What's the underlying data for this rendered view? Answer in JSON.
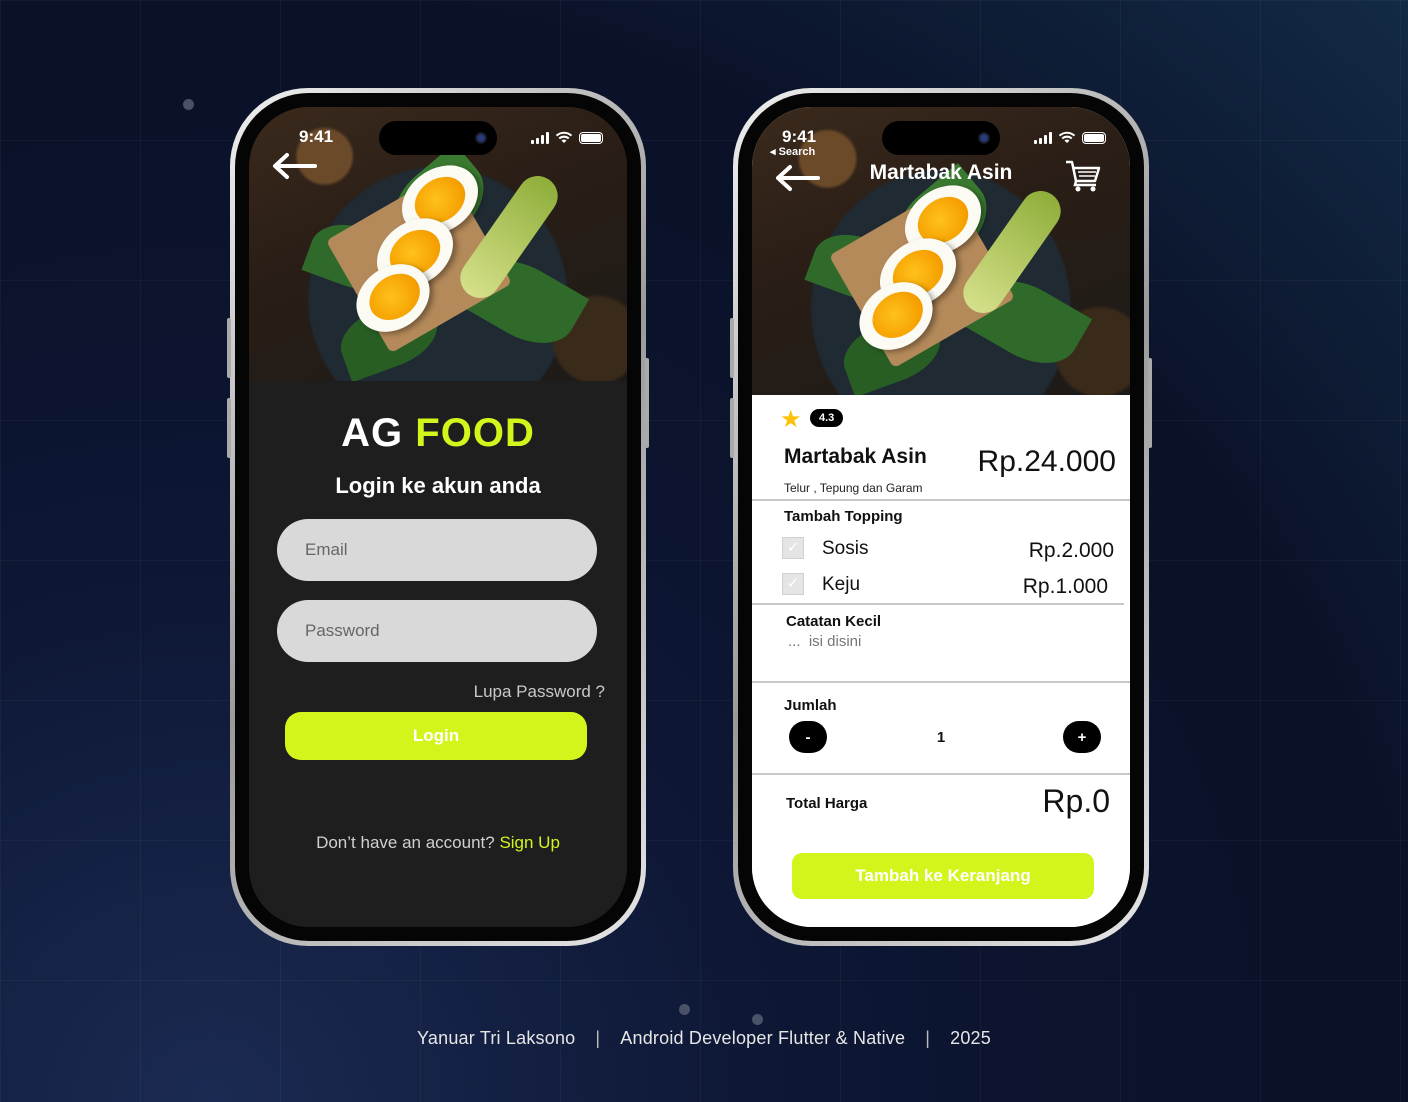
{
  "status_bar": {
    "time": "9:41",
    "search_back": "◂ Search"
  },
  "login": {
    "brand_part1": "AG",
    "brand_part2": "FOOD",
    "subtitle": "Login ke akun anda",
    "email_placeholder": "Email",
    "password_placeholder": "Password",
    "forgot_label": "Lupa Password ?",
    "login_label": "Login",
    "signup_prompt": "Don’t have an account?",
    "signup_link": "Sign Up"
  },
  "detail": {
    "nav_title": "Martabak Asin",
    "rating": "4.3",
    "name": "Martabak Asin",
    "price": "Rp.24.000",
    "description": "Telur , Tepung  dan Garam",
    "topping_title": "Tambah Topping",
    "toppings": [
      {
        "name": "Sosis",
        "price": "Rp.2.000"
      },
      {
        "name": "Keju",
        "price": "Rp.1.000"
      }
    ],
    "note_title": "Catatan  Kecil",
    "note_placeholder": "...  isi disini",
    "qty_title": "Jumlah",
    "qty_minus": "-",
    "qty_value": "1",
    "qty_plus": "+",
    "total_label": "Total Harga",
    "total_value": "Rp.0",
    "add_to_cart": "Tambah ke Keranjang"
  },
  "footer": {
    "author": "Yanuar Tri Laksono",
    "role": "Android Developer Flutter & Native",
    "year": "2025"
  },
  "colors": {
    "accent": "#d4f51c",
    "dark_bg": "#1e1e1e",
    "page_bg": "#0a1128"
  },
  "icons": [
    "back-arrow-icon",
    "cart-icon",
    "star-icon",
    "signal-icon",
    "wifi-icon",
    "battery-icon",
    "checkbox-icon"
  ]
}
